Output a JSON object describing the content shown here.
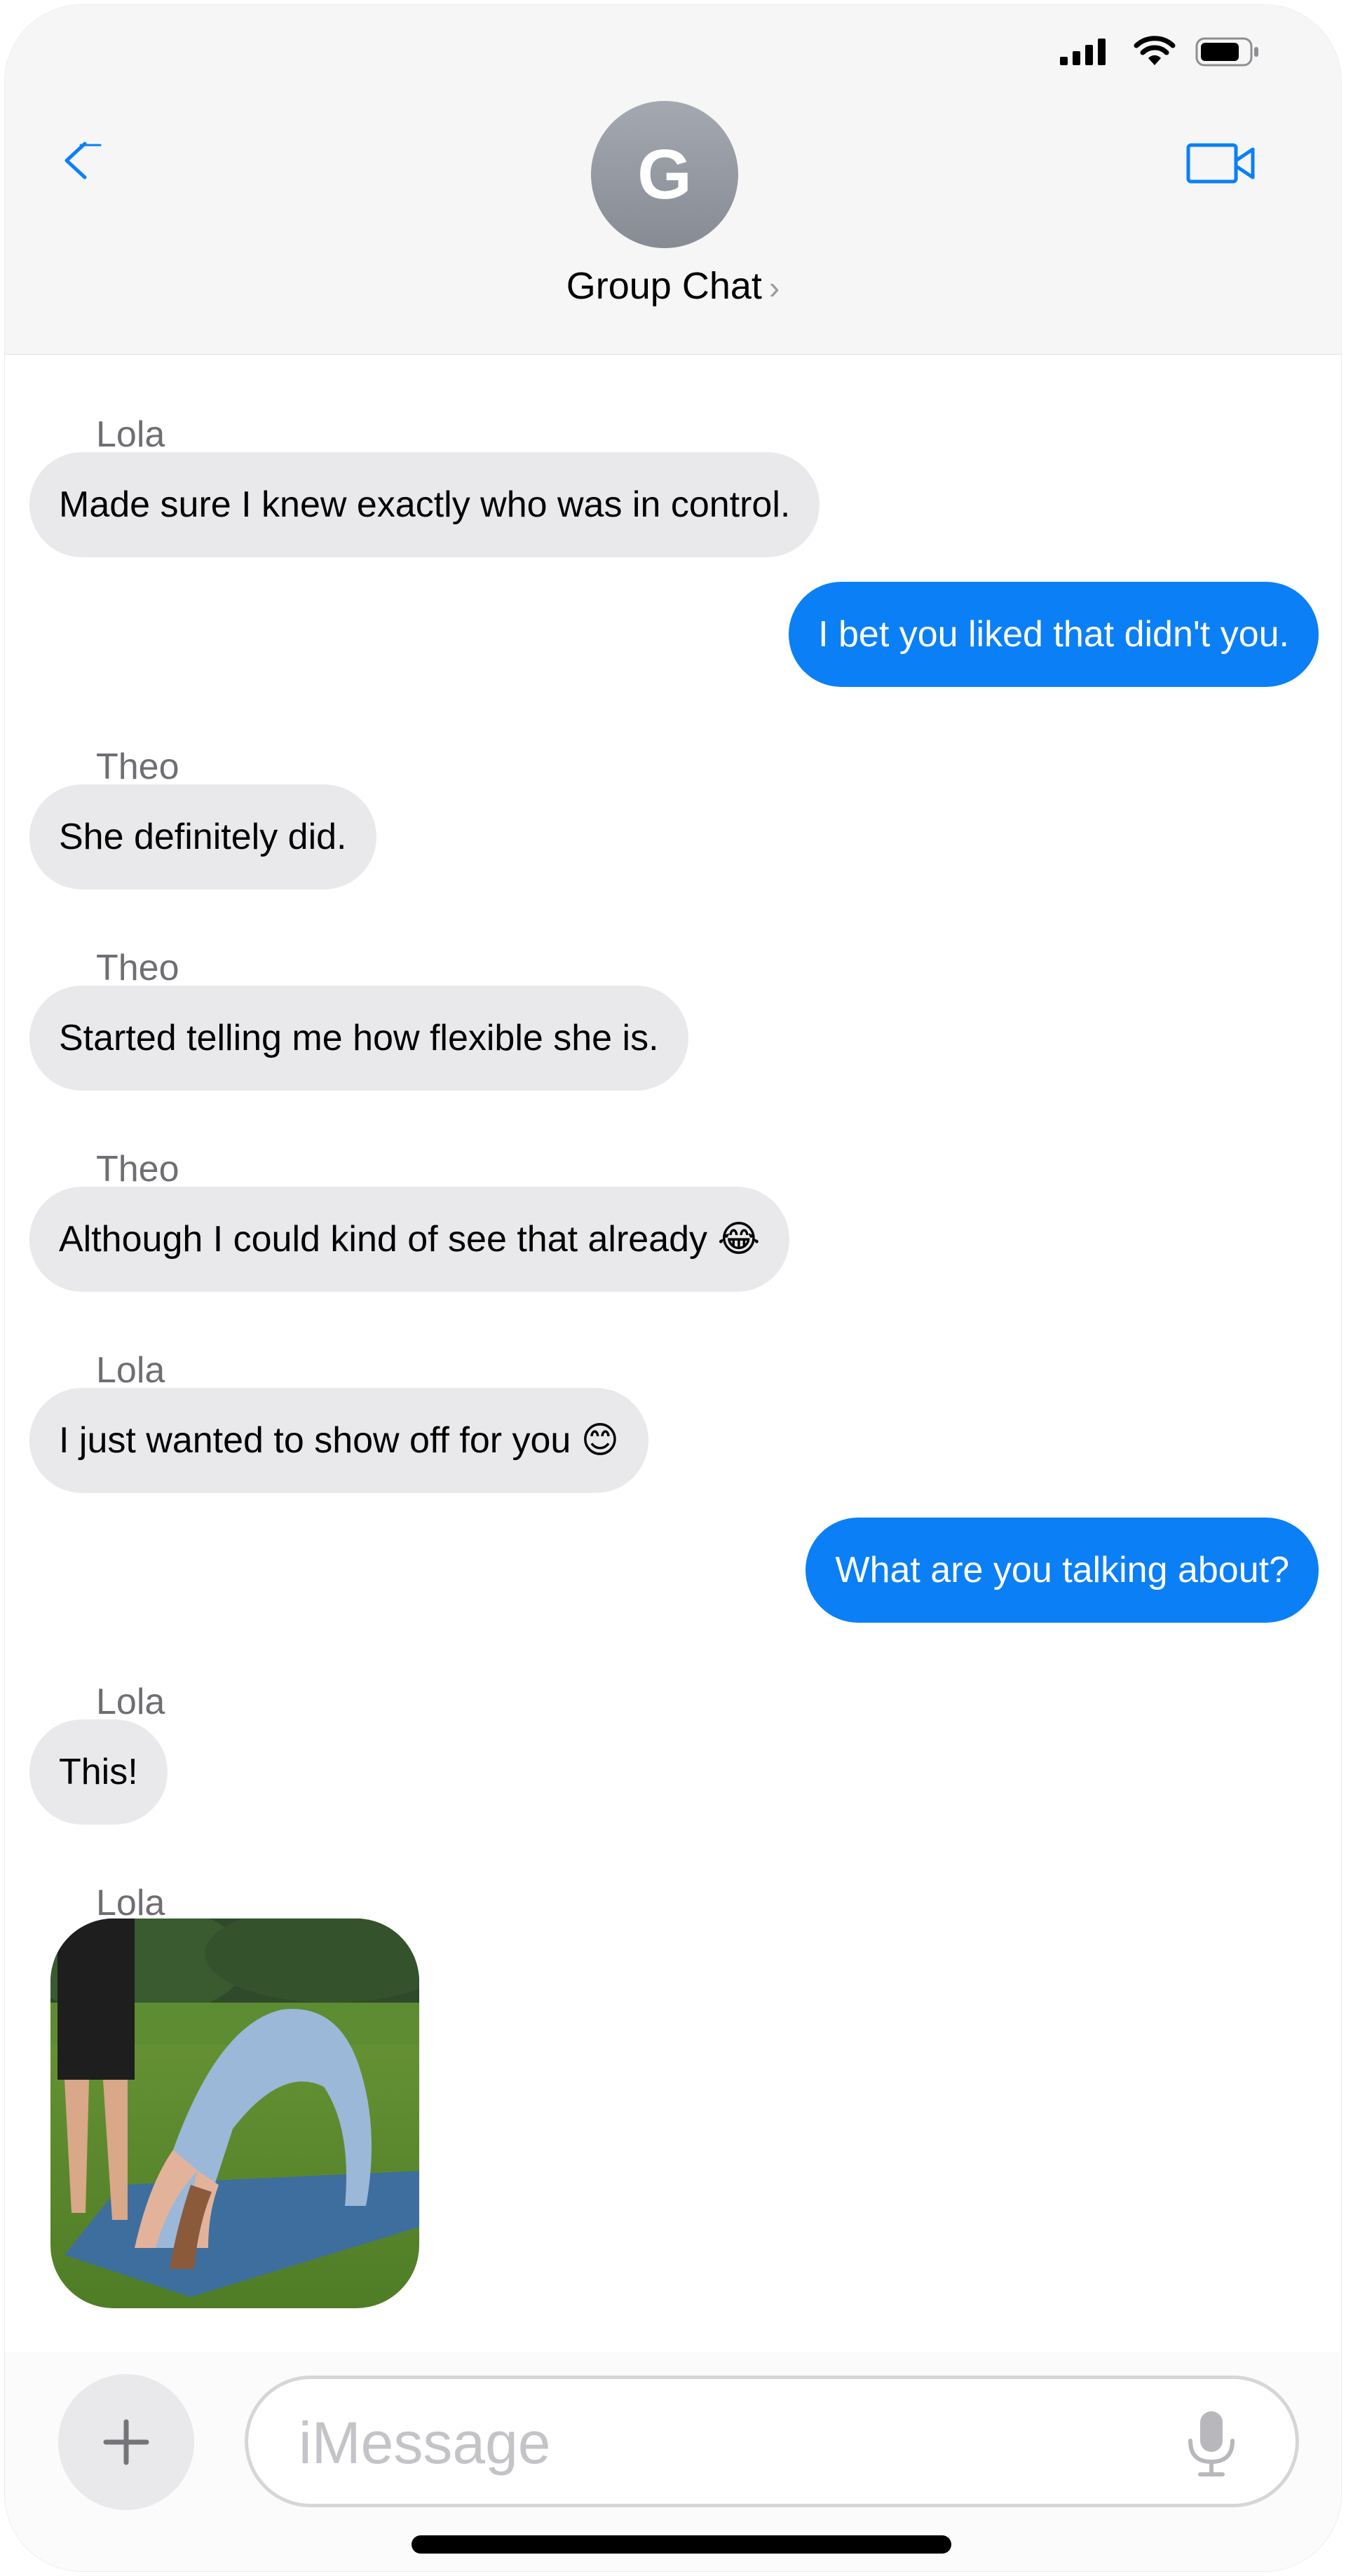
{
  "header": {
    "avatar_letter": "G",
    "title": "Group Chat",
    "title_chevron": "›",
    "accent_color": "#0b7ff6"
  },
  "status_bar": {
    "icons": [
      "cellular-signal-icon",
      "wifi-icon",
      "battery-icon"
    ]
  },
  "messages": [
    {
      "sender": "Lola",
      "direction": "incoming",
      "text": "Made sure I knew exactly who was in control."
    },
    {
      "direction": "outgoing",
      "text": "I bet you liked that didn't you."
    },
    {
      "sender": "Theo",
      "direction": "incoming",
      "text": "She definitely did."
    },
    {
      "sender": "Theo",
      "direction": "incoming",
      "text": "Started telling me how flexible she is."
    },
    {
      "sender": "Theo",
      "direction": "incoming",
      "text": "Although I could kind of see that already 😂"
    },
    {
      "sender": "Lola",
      "direction": "incoming",
      "text": "I just wanted to show off for you 😊"
    },
    {
      "direction": "outgoing",
      "text": "What are you talking about?"
    },
    {
      "sender": "Lola",
      "direction": "incoming",
      "text": "This!"
    },
    {
      "sender": "Lola",
      "direction": "incoming",
      "type": "image",
      "image_desc": "photo-attachment"
    }
  ],
  "composer": {
    "placeholder": "iMessage",
    "value": ""
  },
  "colors": {
    "incoming_bubble": "#e9e9eb",
    "outgoing_bubble": "#0b7ff6",
    "sender_name": "#6e6e73"
  }
}
